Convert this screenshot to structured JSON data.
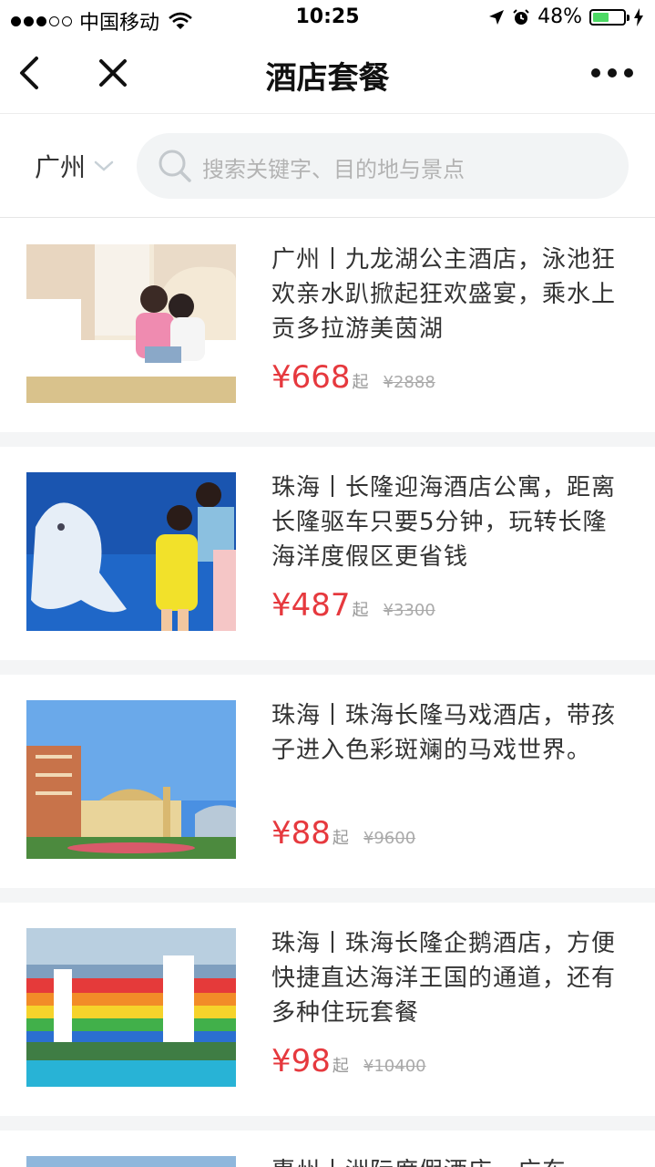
{
  "status_bar": {
    "carrier": "中国移动",
    "time": "10:25",
    "battery_percent": "48%"
  },
  "nav": {
    "title": "酒店套餐"
  },
  "search": {
    "city": "广州",
    "placeholder": "搜索关键字、目的地与景点"
  },
  "items": [
    {
      "title": "广州丨九龙湖公主酒店，泳池狂欢亲水趴掀起狂欢盛宴，乘水上贡多拉游美茵湖",
      "price": "¥668",
      "suffix": "起",
      "original": "¥2888"
    },
    {
      "title": "珠海丨长隆迎海酒店公寓，距离长隆驱车只要5分钟，玩转长隆海洋度假区更省钱",
      "price": "¥487",
      "suffix": "起",
      "original": "¥3300"
    },
    {
      "title": "珠海丨珠海长隆马戏酒店，带孩子进入色彩斑斓的马戏世界。",
      "price": "¥88",
      "suffix": "起",
      "original": "¥9600"
    },
    {
      "title": "珠海丨珠海长隆企鹅酒店，方便快捷直达海洋王国的通道，还有多种住玩套餐",
      "price": "¥98",
      "suffix": "起",
      "original": "¥10400"
    },
    {
      "title": "惠州丨洲际度假酒店，广东"
    }
  ],
  "colors": {
    "price": "#e6393e",
    "battery": "#4cd964",
    "separator": "#f4f5f6"
  }
}
